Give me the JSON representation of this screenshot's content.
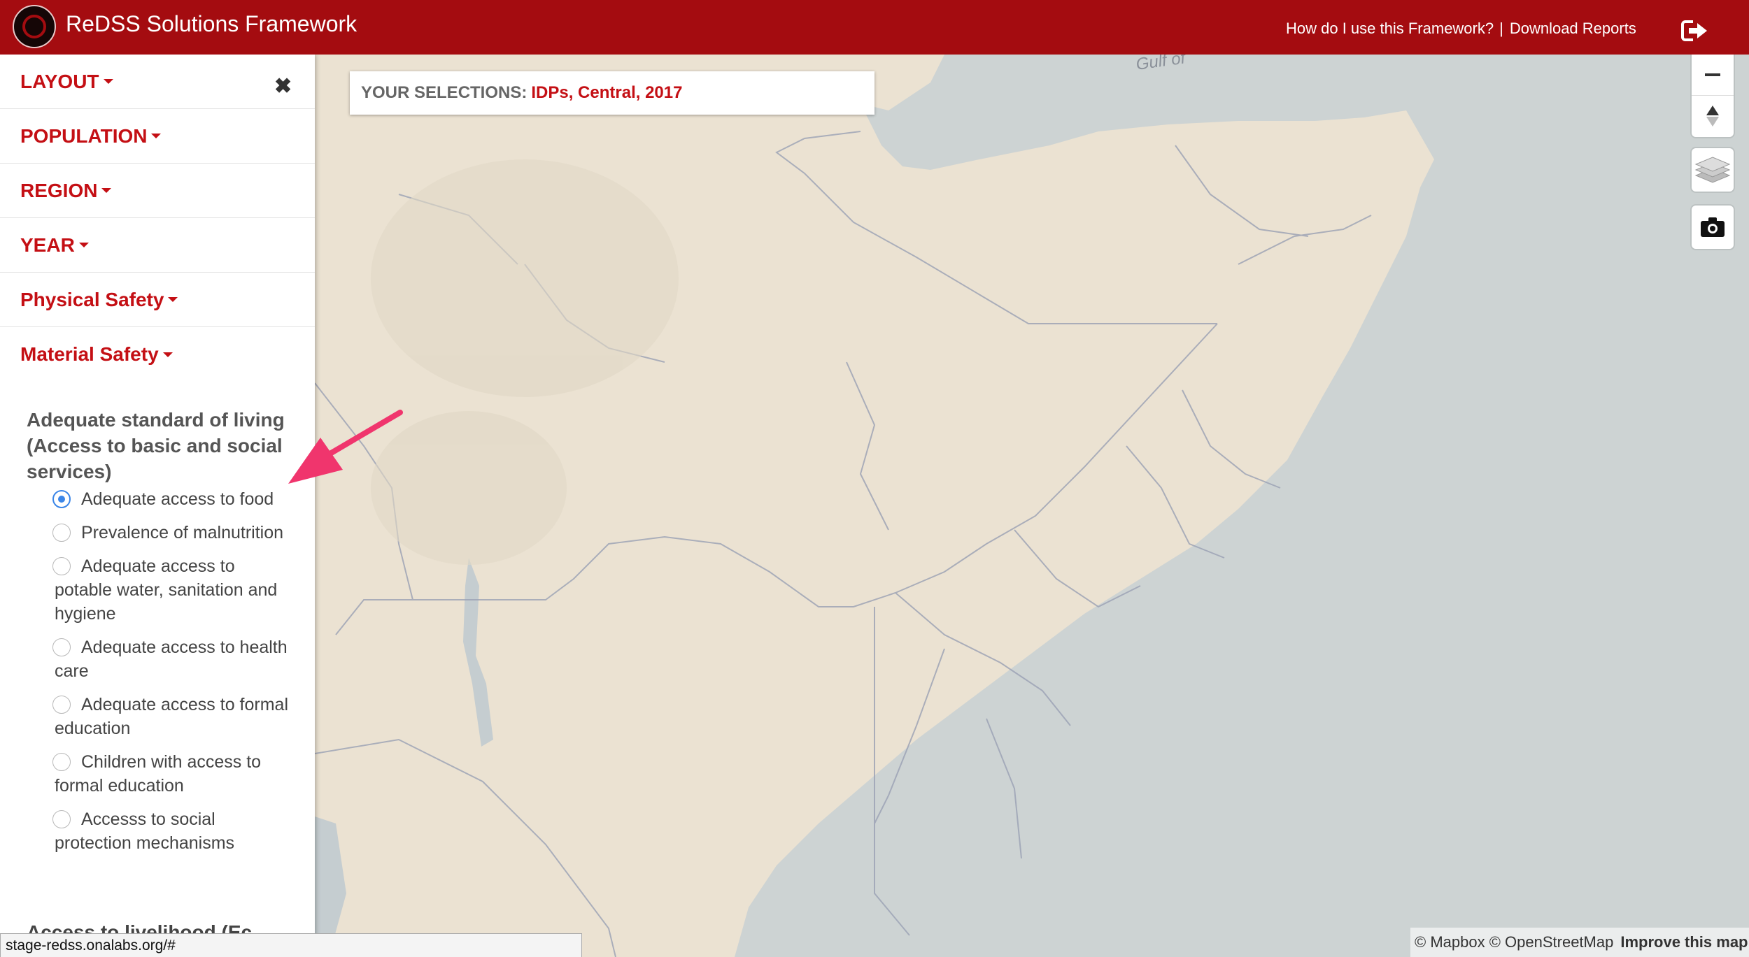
{
  "header": {
    "title": "ReDSS Solutions Framework",
    "help_link": "How do I use this Framework?",
    "separator": "|",
    "download_link": "Download Reports",
    "logo_icon": "redss-logo-icon",
    "logout_icon": "logout-icon",
    "brand_color": "#a40c10"
  },
  "sidebar": {
    "close_icon": "close-icon",
    "menu": [
      {
        "label": "LAYOUT"
      },
      {
        "label": "POPULATION"
      },
      {
        "label": "REGION"
      },
      {
        "label": "YEAR"
      },
      {
        "label": "Physical Safety"
      },
      {
        "label": "Material Safety"
      }
    ],
    "subsection": {
      "heading": "Adequate standard of living (Access to basic and social services)",
      "options": [
        {
          "label": "Adequate access to food",
          "checked": true
        },
        {
          "label": "Prevalence of malnutrition",
          "checked": false
        },
        {
          "label": "Adequate access to potable water, sanitation and hygiene",
          "checked": false
        },
        {
          "label": "Adequate access to health care",
          "checked": false
        },
        {
          "label": "Adequate access to formal education",
          "checked": false
        },
        {
          "label": "Children with access to formal education",
          "checked": false
        },
        {
          "label": "Accesss to social protection mechanisms",
          "checked": false
        }
      ],
      "next_heading_partial": "Access to livelihood (Ec"
    },
    "accent_color": "#c40f14"
  },
  "selection": {
    "label": "YOUR SELECTIONS:",
    "value": "IDPs, Central, 2017"
  },
  "map": {
    "gulf_label": "Gulf of",
    "controls": [
      "zoom-out-icon",
      "compass-icon",
      "layers-icon",
      "camera-icon"
    ],
    "land_color": "#ebe2d2",
    "water_color": "#cdd3d3"
  },
  "attribution": {
    "text": "© Mapbox © OpenStreetMap",
    "improve": "Improve this map"
  },
  "status_bar": {
    "url": "stage-redss.onalabs.org/#"
  }
}
